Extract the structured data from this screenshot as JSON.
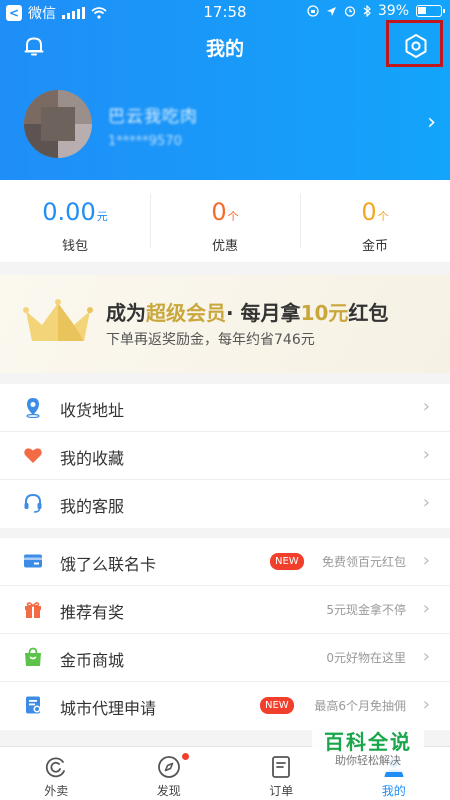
{
  "status_bar": {
    "back_app": "微信",
    "time": "17:58",
    "battery": "39%"
  },
  "header": {
    "title": "我的",
    "user_name": "巴云我吃肉",
    "user_phone": "1*****9570"
  },
  "stats": [
    {
      "value": "0.00",
      "unit": "元",
      "label": "钱包",
      "color": "#1f8ef7"
    },
    {
      "value": "0",
      "unit": "个",
      "label": "优惠",
      "color": "#f56b2c"
    },
    {
      "value": "0",
      "unit": "个",
      "label": "金币",
      "color": "#f5a623"
    }
  ],
  "vip": {
    "title_pre": "成为",
    "title_highlight": "超级会员",
    "title_mid": "· 每月拿",
    "title_amount": "10元",
    "title_post": "红包",
    "subtitle": "下单再返奖励金，每年约省746元"
  },
  "list_primary": [
    {
      "label": "收货地址",
      "icon": "location-icon"
    },
    {
      "label": "我的收藏",
      "icon": "heart-icon"
    },
    {
      "label": "我的客服",
      "icon": "headset-icon"
    }
  ],
  "list_secondary": [
    {
      "label": "饿了么联名卡",
      "icon": "card-icon",
      "tag": "NEW",
      "hint": "免费领百元红包"
    },
    {
      "label": "推荐有奖",
      "icon": "gift-icon",
      "tag": "",
      "hint": "5元现金拿不停"
    },
    {
      "label": "金币商城",
      "icon": "shop-bag-icon",
      "tag": "",
      "hint": "0元好物在这里"
    },
    {
      "label": "城市代理申请",
      "icon": "agent-doc-icon",
      "tag": "NEW",
      "hint": "最高6个月免抽佣"
    }
  ],
  "tabbar": [
    {
      "label": "外卖",
      "icon": "takeout-icon",
      "active": false
    },
    {
      "label": "发现",
      "icon": "compass-icon",
      "active": false
    },
    {
      "label": "订单",
      "icon": "order-icon",
      "active": false
    },
    {
      "label": "我的",
      "icon": "profile-icon",
      "active": true
    }
  ],
  "watermark": {
    "main": "百科全说",
    "sub": "助你轻松解决"
  }
}
